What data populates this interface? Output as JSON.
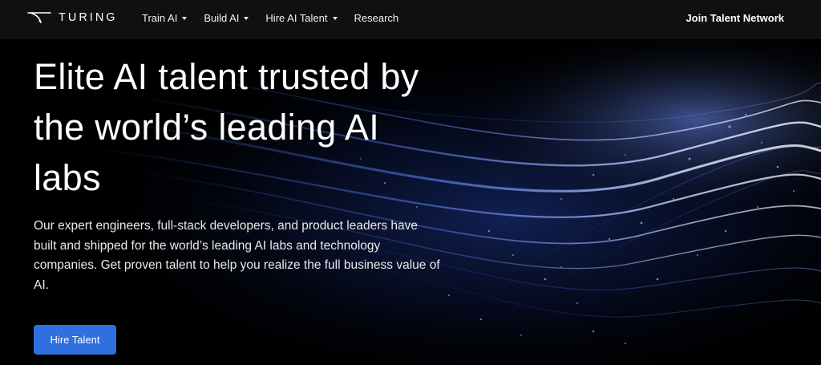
{
  "brand": {
    "name": "TURING",
    "logo_icon": "turing-swoosh-icon"
  },
  "nav": {
    "items": [
      {
        "label": "Train AI",
        "has_dropdown": true
      },
      {
        "label": "Build AI",
        "has_dropdown": true
      },
      {
        "label": "Hire AI Talent",
        "has_dropdown": true
      },
      {
        "label": "Research",
        "has_dropdown": false
      }
    ],
    "right_link": "Join Talent Network"
  },
  "hero": {
    "title_lines": [
      "Elite AI talent trusted by",
      "the world’s leading AI",
      "labs"
    ],
    "description_lines": [
      "Our expert engineers, full-stack developers, and product leaders have",
      "built and shipped for the world’s leading AI labs and technology",
      "companies. Get proven talent to help you realize the full business value of",
      "AI."
    ],
    "cta_label": "Hire Talent"
  },
  "colors": {
    "accent": "#2f6fdf",
    "nav_bg": "#101010",
    "background": "#000000"
  }
}
